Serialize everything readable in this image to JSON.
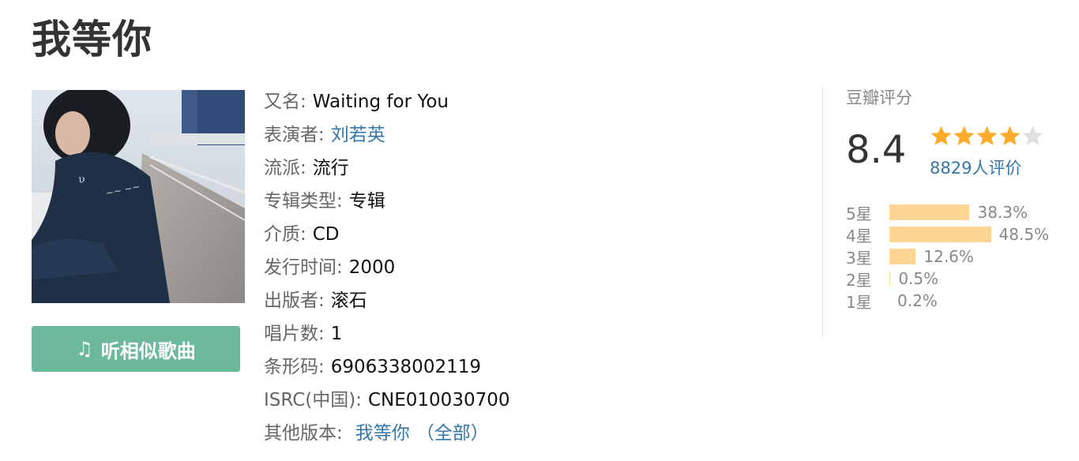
{
  "title": "我等你",
  "cover": {
    "icon": "album-cover-image"
  },
  "listen_button": {
    "icon": "music-note-icon",
    "glyph": "♫",
    "label": "听相似歌曲"
  },
  "info": {
    "alias_label": "又名:",
    "alias_value": "Waiting for You",
    "performer_label": "表演者:",
    "performer_value": "刘若英",
    "genre_label": "流派:",
    "genre_value": "流行",
    "type_label": "专辑类型:",
    "type_value": "专辑",
    "medium_label": "介质:",
    "medium_value": "CD",
    "release_label": "发行时间:",
    "release_value": "2000",
    "publisher_label": "出版者:",
    "publisher_value": "滚石",
    "discs_label": "唱片数:",
    "discs_value": "1",
    "barcode_label": "条形码:",
    "barcode_value": "6906338002119",
    "isrc_label": "ISRC(中国):",
    "isrc_value": "CNE010030700",
    "versions_label": "其他版本:",
    "versions_link": "我等你",
    "versions_open": "（",
    "versions_all": "全部",
    "versions_close": "）"
  },
  "rating": {
    "header": "豆瓣评分",
    "score": "8.4",
    "stars_filled": 4,
    "stars_total": 5,
    "votes": "8829人评价",
    "colors": {
      "star_on": "#ffac2d",
      "star_off": "#e0e0e0",
      "bar": "#ffd596",
      "link": "#3377aa"
    },
    "distribution": [
      {
        "label": "5星",
        "percent": "38.3%",
        "value": 38.3
      },
      {
        "label": "4星",
        "percent": "48.5%",
        "value": 48.5
      },
      {
        "label": "3星",
        "percent": "12.6%",
        "value": 12.6
      },
      {
        "label": "2星",
        "percent": "0.5%",
        "value": 0.5
      },
      {
        "label": "1星",
        "percent": "0.2%",
        "value": 0.2
      }
    ]
  }
}
